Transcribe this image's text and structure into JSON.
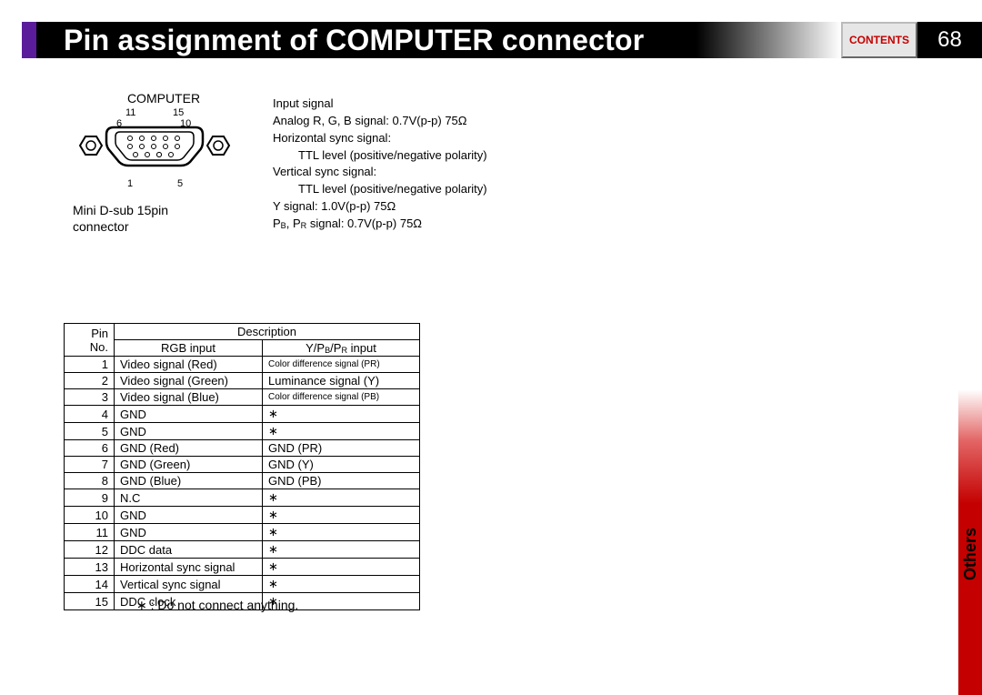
{
  "header": {
    "title": "Pin assignment of COMPUTER connector",
    "contents_label": "CONTENTS",
    "page_number": "68"
  },
  "side_tab": {
    "label": "Others"
  },
  "connector": {
    "top_label": "COMPUTER",
    "caption_line1": "Mini D-sub 15pin",
    "caption_line2": "connector",
    "pin_labels": {
      "tl": "11",
      "tr": "15",
      "ml": "6",
      "mr": "10",
      "bl": "1",
      "br": "5"
    }
  },
  "specs": {
    "l1": "Input signal",
    "l2": "Analog R, G, B signal: 0.7V(p-p) 75Ω",
    "l3": "Horizontal sync signal:",
    "l3s": "TTL level (positive/negative polarity)",
    "l4": "Vertical sync signal:",
    "l4s": "TTL level  (positive/negative polarity)",
    "l5": "Y signal: 1.0V(p-p) 75Ω",
    "l6_pre": "P",
    "l6_b": "B",
    "l6_mid": ", P",
    "l6_r": "R",
    "l6_post": " signal: 0.7V(p-p) 75Ω"
  },
  "table": {
    "head_pin": "Pin No.",
    "head_desc": "Description",
    "head_rgb": "RGB input",
    "head_ypbpr_y": "Y/P",
    "head_ypbpr_b": "B",
    "head_ypbpr_mid": "/P",
    "head_ypbpr_r": "R",
    "head_ypbpr_end": " input",
    "rows": [
      {
        "n": "1",
        "a": "Video signal (Red)",
        "b": "Color difference signal (PR)",
        "small": true
      },
      {
        "n": "2",
        "a": "Video signal (Green)",
        "b": "Luminance signal (Y)"
      },
      {
        "n": "3",
        "a": "Video signal (Blue)",
        "b": "Color difference signal (PB)",
        "small": true
      },
      {
        "n": "4",
        "a": "GND",
        "b": "∗"
      },
      {
        "n": "5",
        "a": "GND",
        "b": "∗"
      },
      {
        "n": "6",
        "a": "GND (Red)",
        "b": "GND (PR)"
      },
      {
        "n": "7",
        "a": "GND (Green)",
        "b": "GND (Y)"
      },
      {
        "n": "8",
        "a": "GND (Blue)",
        "b": "GND (PB)"
      },
      {
        "n": "9",
        "a": "N.C",
        "b": "∗"
      },
      {
        "n": "10",
        "a": "GND",
        "b": "∗"
      },
      {
        "n": "11",
        "a": "GND",
        "b": "∗"
      },
      {
        "n": "12",
        "a": "DDC data",
        "b": "∗"
      },
      {
        "n": "13",
        "a": "Horizontal sync signal",
        "b": "∗"
      },
      {
        "n": "14",
        "a": "Vertical sync signal",
        "b": "∗"
      },
      {
        "n": "15",
        "a": "DDC clock",
        "b": "∗"
      }
    ],
    "footnote": "∗ : Do not connect anything."
  }
}
